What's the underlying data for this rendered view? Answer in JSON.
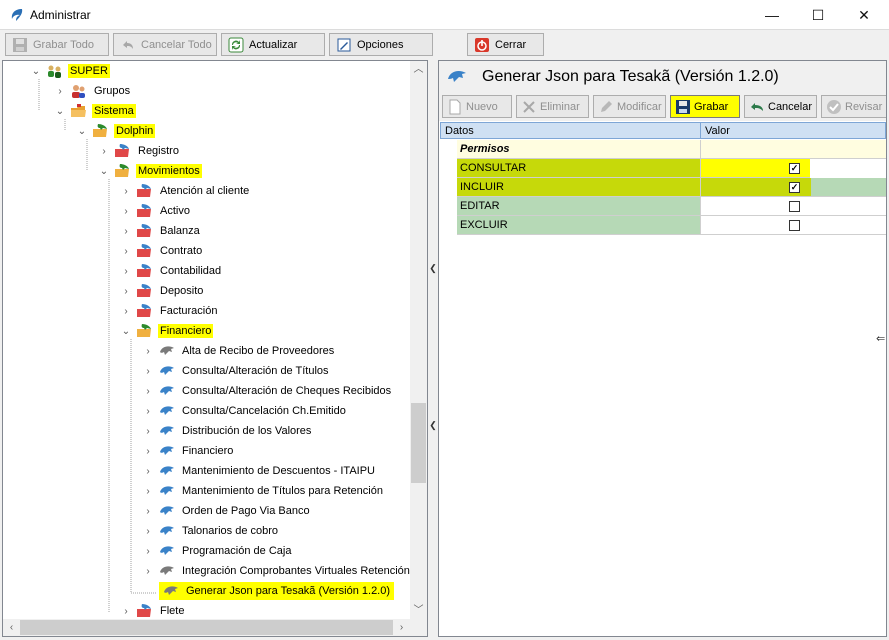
{
  "window": {
    "title": "Administrar",
    "minimize_glyph": "—",
    "maximize_glyph": "☐",
    "close_glyph": "✕"
  },
  "toolbar": {
    "save_all": "Grabar Todo",
    "cancel_all": "Cancelar Todo",
    "refresh": "Actualizar",
    "options": "Opciones",
    "close": "Cerrar"
  },
  "tree": {
    "nodes": [
      {
        "label": "SUPER",
        "highlighted": true,
        "icon": "user-group-icon"
      },
      {
        "label": "Grupos",
        "highlighted": false,
        "icon": "users-icon"
      },
      {
        "label": "Sistema",
        "highlighted": true,
        "icon": "folder-icon"
      },
      {
        "label": "Dolphin",
        "highlighted": true,
        "icon": "module-icon"
      },
      {
        "label": "Registro",
        "highlighted": false,
        "icon": "module-icon"
      },
      {
        "label": "Movimientos",
        "highlighted": true,
        "icon": "module-icon"
      },
      {
        "label": "Atención al cliente",
        "highlighted": false,
        "icon": "module-icon"
      },
      {
        "label": "Activo",
        "highlighted": false,
        "icon": "module-icon"
      },
      {
        "label": "Balanza",
        "highlighted": false,
        "icon": "module-icon"
      },
      {
        "label": "Contrato",
        "highlighted": false,
        "icon": "module-icon"
      },
      {
        "label": "Contabilidad",
        "highlighted": false,
        "icon": "module-icon"
      },
      {
        "label": "Deposito",
        "highlighted": false,
        "icon": "module-icon"
      },
      {
        "label": "Facturación",
        "highlighted": false,
        "icon": "module-icon"
      },
      {
        "label": "Financiero",
        "highlighted": true,
        "icon": "module-icon"
      },
      {
        "label": "Alta de Recibo de Proveedores",
        "highlighted": false,
        "icon": "dolphin-gray-icon"
      },
      {
        "label": "Consulta/Alteración de Títulos",
        "highlighted": false,
        "icon": "dolphin-icon"
      },
      {
        "label": "Consulta/Alteración de Cheques Recibidos",
        "highlighted": false,
        "icon": "dolphin-icon"
      },
      {
        "label": "Consulta/Cancelación Ch.Emitido",
        "highlighted": false,
        "icon": "dolphin-icon"
      },
      {
        "label": "Distribución de los Valores",
        "highlighted": false,
        "icon": "dolphin-icon"
      },
      {
        "label": "Financiero",
        "highlighted": false,
        "icon": "dolphin-icon"
      },
      {
        "label": "Mantenimiento de Descuentos - ITAIPU",
        "highlighted": false,
        "icon": "dolphin-icon"
      },
      {
        "label": "Mantenimiento de Títulos para Retención",
        "highlighted": false,
        "icon": "dolphin-icon"
      },
      {
        "label": "Orden de Pago Via Banco",
        "highlighted": false,
        "icon": "dolphin-icon"
      },
      {
        "label": "Talonarios de cobro",
        "highlighted": false,
        "icon": "dolphin-icon"
      },
      {
        "label": "Programación de Caja",
        "highlighted": false,
        "icon": "dolphin-icon"
      },
      {
        "label": "Integración Comprobantes Virtuales Retención -",
        "highlighted": false,
        "icon": "dolphin-gray-icon"
      },
      {
        "label": "Generar Json para Tesakã (Versión 1.2.0)",
        "highlighted": true,
        "icon": "dolphin-gray-icon"
      },
      {
        "label": "Flete",
        "highlighted": false,
        "icon": "module-icon"
      }
    ]
  },
  "detail": {
    "title": "Generar Json para Tesakã (Versión 1.2.0)",
    "buttons": {
      "new": "Nuevo",
      "delete": "Eliminar",
      "modify": "Modificar",
      "save": "Grabar",
      "cancel": "Cancelar",
      "review": "Revisar"
    },
    "grid": {
      "col_data": "Datos",
      "col_value": "Valor",
      "group": "Permisos",
      "rows": [
        {
          "label": "CONSULTAR",
          "checked": true
        },
        {
          "label": "INCLUIR",
          "checked": true
        },
        {
          "label": "EDITAR",
          "checked": false
        },
        {
          "label": "EXCLUIR",
          "checked": false
        }
      ]
    }
  },
  "colors": {
    "highlight": "#ffff00",
    "row_selected": "#c6d90a",
    "row_normal": "#b6d9b6",
    "grid_header": "#cfe0f3"
  }
}
